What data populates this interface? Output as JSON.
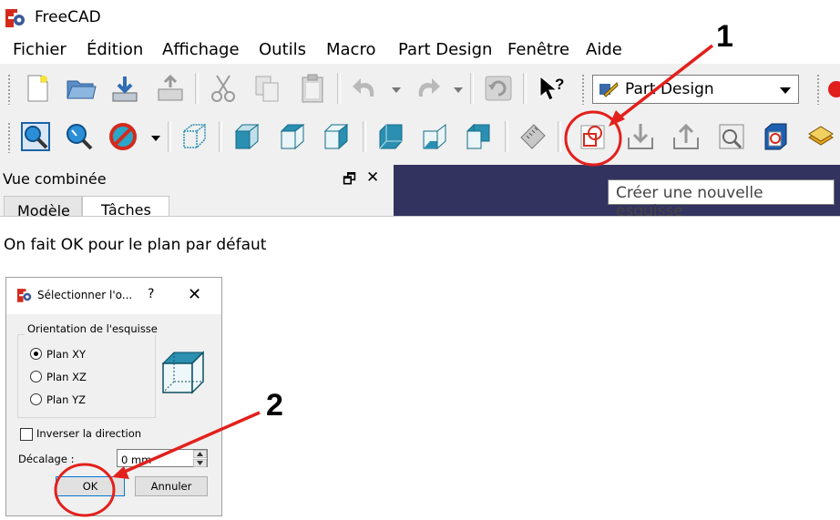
{
  "app": {
    "title": "FreeCAD"
  },
  "menu": [
    "Fichier",
    "Édition",
    "Affichage",
    "Outils",
    "Macro",
    "Part Design",
    "Fenêtre",
    "Aide"
  ],
  "workbench": {
    "selected": "Part Design"
  },
  "combo_view": {
    "title": "Vue combinée",
    "undock": "🗗",
    "close": "✕",
    "tabs": [
      "Modèle",
      "Tâches"
    ]
  },
  "tooltip": "Créer une nouvelle esquisse",
  "annotations": {
    "step1": "1",
    "step2": "2",
    "accent": "#e3201c"
  },
  "caption": "On fait OK pour le plan par défaut",
  "dialog": {
    "title": "Sélectionner l'o...",
    "help": "?",
    "close": "✕",
    "group_title": "Orientation de l'esquisse",
    "options": [
      "Plan XY",
      "Plan XZ",
      "Plan YZ"
    ],
    "selected_option": "Plan XY",
    "reverse_label": "Inverser la direction",
    "reverse_checked": false,
    "offset_label": "Décalage :",
    "offset_value": "0 mm",
    "ok": "OK",
    "cancel": "Annuler"
  }
}
